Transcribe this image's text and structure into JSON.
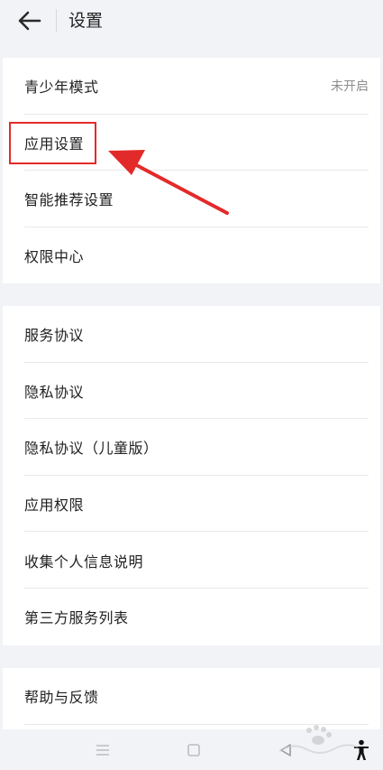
{
  "header": {
    "title": "设置"
  },
  "group1": {
    "items": [
      {
        "label": "青少年模式",
        "value": "未开启"
      },
      {
        "label": "应用设置"
      },
      {
        "label": "智能推荐设置"
      },
      {
        "label": "权限中心"
      }
    ]
  },
  "group2": {
    "items": [
      {
        "label": "服务协议"
      },
      {
        "label": "隐私协议"
      },
      {
        "label": "隐私协议（儿童版）"
      },
      {
        "label": "应用权限"
      },
      {
        "label": "收集个人信息说明"
      },
      {
        "label": "第三方服务列表"
      }
    ]
  },
  "group3": {
    "items": [
      {
        "label": "帮助与反馈"
      }
    ]
  },
  "annotation": {
    "highlight_color": "#e32a2a"
  },
  "navbar": {
    "icons": [
      "menu-icon",
      "home-square-icon",
      "back-triangle-icon",
      "accessibility-icon"
    ]
  }
}
